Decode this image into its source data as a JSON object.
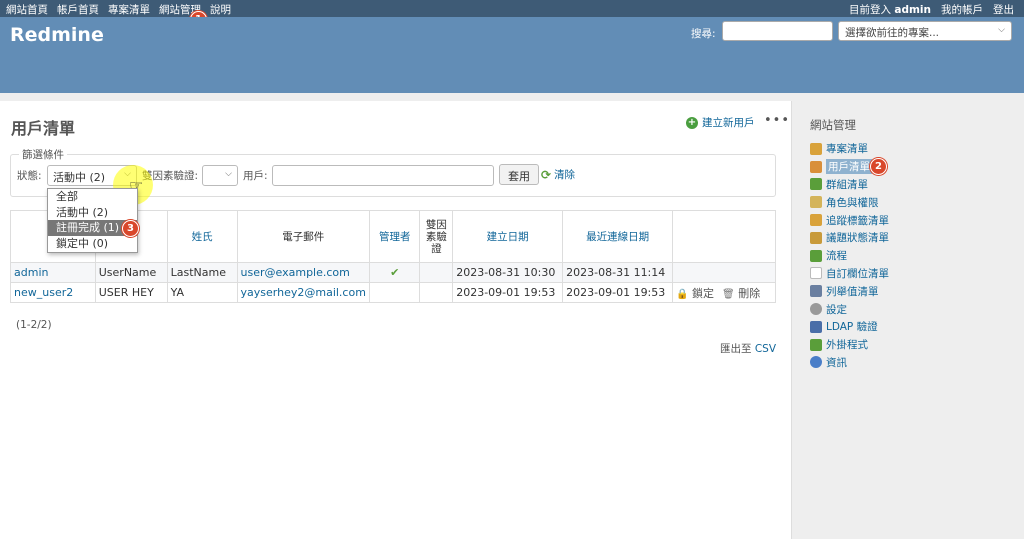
{
  "top_menu": {
    "items": [
      "網站首頁",
      "帳戶首頁",
      "專案清單",
      "網站管理",
      "說明"
    ],
    "logged_in_prefix": "目前登入",
    "logged_in_user": "admin",
    "my_account": "我的帳戶",
    "logout": "登出"
  },
  "header": {
    "title": "Redmine",
    "search_label": "搜尋:",
    "project_select": "選擇欲前往的專案..."
  },
  "main": {
    "title": "用戶清單",
    "new_user": "建立新用戶",
    "more": "•••",
    "filters": {
      "legend": "篩選條件",
      "status_label": "狀態:",
      "status_value": "活動中 (2)",
      "twofa_label": "雙因素驗證:",
      "user_label": "用戶:",
      "apply": "套用",
      "clear": "清除"
    },
    "dropdown_options": [
      "全部",
      "活動中 (2)",
      "註冊完成 (1)",
      "鎖定中 (0)"
    ],
    "columns": [
      "帳戶",
      "名字",
      "姓氏",
      "電子郵件",
      "管理者",
      "雙因素驗證",
      "建立日期",
      "最近連線日期",
      ""
    ],
    "col_header_login_visible": "帳",
    "col_header_twofa_lines": [
      "雙因",
      "素驗",
      "證"
    ],
    "rows": [
      {
        "login": "admin",
        "firstname": "UserName",
        "lastname": "LastName",
        "email": "user@example.com",
        "admin": "✔",
        "twofa": "",
        "created": "2023-08-31 10:30",
        "last_login": "2023-08-31 11:14",
        "lock": "",
        "delete": ""
      },
      {
        "login": "new_user2",
        "firstname": "USER HEY",
        "lastname": "YA",
        "email": "yayserhey2@mail.com",
        "admin": "",
        "twofa": "",
        "created": "2023-09-01 19:53",
        "last_login": "2023-09-01 19:53",
        "lock": "鎖定",
        "delete": "刪除"
      }
    ],
    "count": "(1-2/2)",
    "export_prefix": "匯出至",
    "export_csv": "CSV"
  },
  "sidebar": {
    "title": "網站管理",
    "items": [
      {
        "label": "專案清單",
        "icon": "projects-icon",
        "color": "#d9a23a"
      },
      {
        "label": "用戶清單",
        "icon": "users-icon",
        "color": "#d98f3a"
      },
      {
        "label": "群組清單",
        "icon": "groups-icon",
        "color": "#5a9e3a"
      },
      {
        "label": "角色與權限",
        "icon": "roles-icon",
        "color": "#d4b45a"
      },
      {
        "label": "追蹤標籤清單",
        "icon": "trackers-icon",
        "color": "#d9a23a"
      },
      {
        "label": "議題狀態清單",
        "icon": "issue-status-icon",
        "color": "#c89a3a"
      },
      {
        "label": "流程",
        "icon": "workflow-icon",
        "color": "#5a9e3a"
      },
      {
        "label": "自訂欄位清單",
        "icon": "custom-fields-icon",
        "color": "#ffffff"
      },
      {
        "label": "列舉值清單",
        "icon": "enumerations-icon",
        "color": "#6a7fa0"
      },
      {
        "label": "設定",
        "icon": "settings-icon",
        "color": "#999999"
      },
      {
        "label": "LDAP 驗證",
        "icon": "ldap-icon",
        "color": "#4a6ea8"
      },
      {
        "label": "外掛程式",
        "icon": "plugins-icon",
        "color": "#5a9e3a"
      },
      {
        "label": "資訊",
        "icon": "info-icon",
        "color": "#4a7ec8"
      }
    ]
  },
  "annotations": {
    "badge1": "1",
    "badge2": "2",
    "badge3": "3"
  }
}
